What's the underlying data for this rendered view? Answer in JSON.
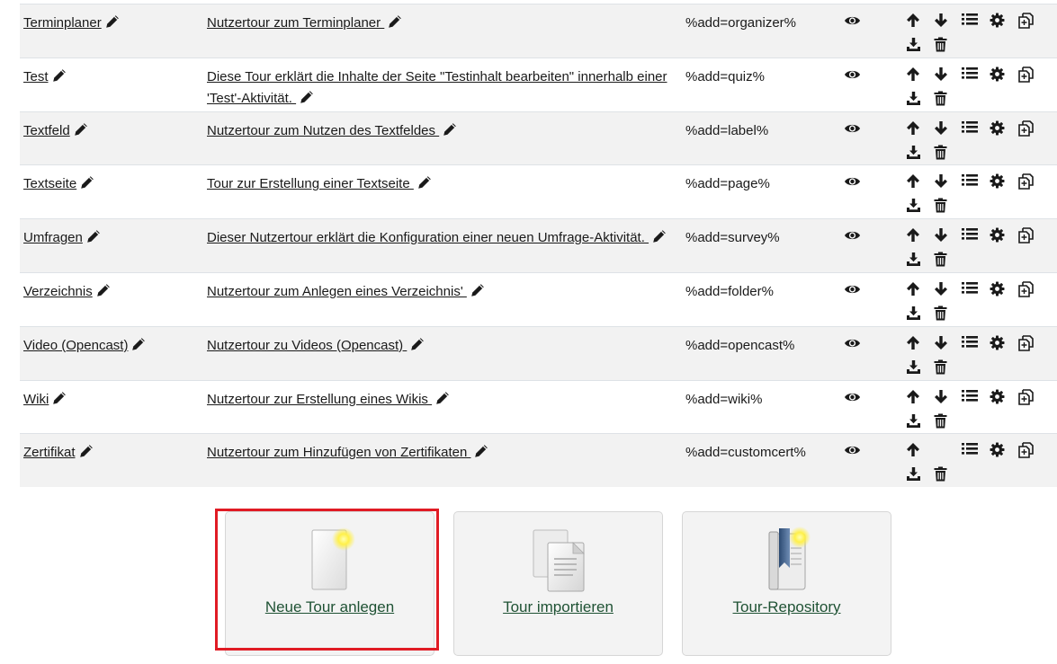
{
  "tours": [
    {
      "name": "Terminplaner",
      "description": "Nutzertour zum Terminplaner ",
      "path": "%add=organizer%",
      "can_move_up": true,
      "can_move_down": true
    },
    {
      "name": "Test",
      "description": "Diese Tour erklärt die Inhalte der Seite \"Testinhalt bearbeiten\" innerhalb einer 'Test'-Aktivität. ",
      "path": "%add=quiz%",
      "can_move_up": true,
      "can_move_down": true
    },
    {
      "name": "Textfeld",
      "description": "Nutzertour zum Nutzen des Textfeldes ",
      "path": "%add=label%",
      "can_move_up": true,
      "can_move_down": true
    },
    {
      "name": "Textseite",
      "description": "Tour zur Erstellung einer Textseite ",
      "path": "%add=page%",
      "can_move_up": true,
      "can_move_down": true
    },
    {
      "name": "Umfragen",
      "description": "Dieser Nutzertour erklärt die Konfiguration einer neuen Umfrage-Aktivität. ",
      "path": "%add=survey%",
      "can_move_up": true,
      "can_move_down": true
    },
    {
      "name": "Verzeichnis",
      "description": "Nutzertour zum Anlegen eines Verzeichnis' ",
      "path": "%add=folder%",
      "can_move_up": true,
      "can_move_down": true
    },
    {
      "name": "Video (Opencast)",
      "description": "Nutzertour zu Videos (Opencast) ",
      "path": "%add=opencast%",
      "can_move_up": true,
      "can_move_down": true
    },
    {
      "name": "Wiki",
      "description": "Nutzertour zur Erstellung eines Wikis ",
      "path": "%add=wiki%",
      "can_move_up": true,
      "can_move_down": true
    },
    {
      "name": "Zertifikat",
      "description": "Nutzertour zum Hinzufügen von Zertifikaten ",
      "path": "%add=customcert%",
      "can_move_up": true,
      "can_move_down": false
    }
  ],
  "icons": {
    "edit": "pencil-icon",
    "enabled": "eye-icon",
    "up": "arrow-up-icon",
    "down": "arrow-down-icon",
    "steps": "list-icon",
    "settings": "gear-icon",
    "duplicate": "copy-icon",
    "export": "download-icon",
    "delete": "trash-icon"
  },
  "actions": {
    "new_tour": "Neue Tour anlegen",
    "import_tour": "Tour importieren",
    "repository": "Tour-Repository"
  },
  "colors": {
    "row_alt": "#f2f2f2",
    "link_card": "#1f5234",
    "highlight": "#e01b24"
  }
}
